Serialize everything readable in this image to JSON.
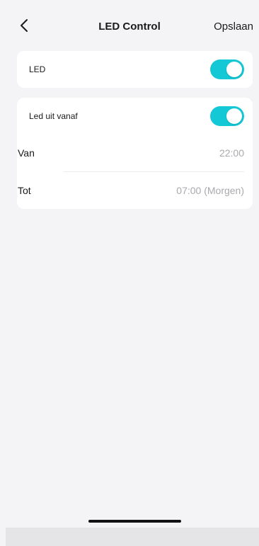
{
  "header": {
    "title": "LED Control",
    "save_label": "Opslaan"
  },
  "led_card": {
    "label": "LED",
    "toggle_on": true
  },
  "schedule_card": {
    "led_off_label": "Led uit vanaf",
    "toggle_on": true,
    "from_label": "Van",
    "from_value": "22:00",
    "to_label": "Tot",
    "to_value": "07:00 (Morgen)"
  },
  "colors": {
    "accent": "#14c8d6",
    "background": "#f4f4f6",
    "card": "#ffffff",
    "secondary_text": "#a9a9ae"
  },
  "icons": {
    "back": "chevron-left-icon"
  }
}
